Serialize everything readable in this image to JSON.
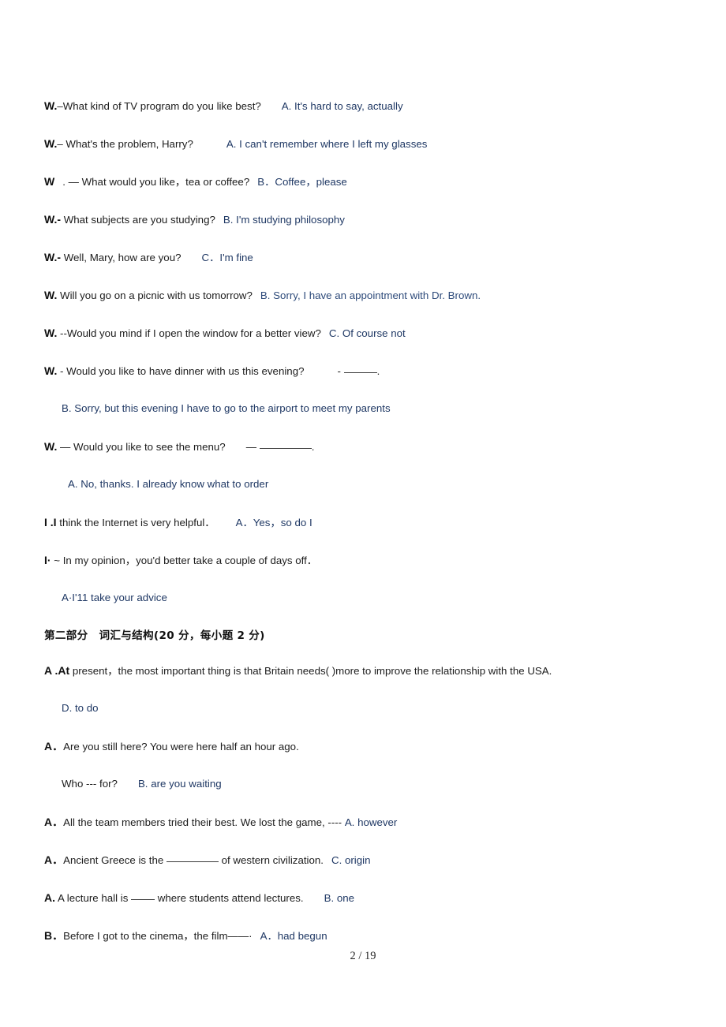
{
  "document": {
    "page_number": "2",
    "page_total": "19",
    "footer_text": "2 / 19",
    "colors": {
      "answer_blue": "#1f3864",
      "body_black": "#1c1c1c",
      "background": "#ffffff"
    }
  },
  "part_one": {
    "questions": [
      {
        "letter": "W.",
        "stem": "–What kind of TV program do you like best?",
        "answer": "A. It's hard to say, actually"
      },
      {
        "letter": "W.",
        "stem": "– What's the problem, Harry?",
        "answer": "A. I can't remember where I left my glasses"
      },
      {
        "letter": "W",
        "stem": ". — What would you like，tea or coffee?",
        "answer": "B．Coffee，please"
      },
      {
        "letter": "W.-",
        "stem": " What subjects are you studying?",
        "answer": "B. I'm    studying    philosophy"
      },
      {
        "letter": "W.-",
        "stem": " Well, Mary, how are you?",
        "answer": "C．I'm fine"
      },
      {
        "letter": "W.",
        "stem": " Will you go on a picnic with us tomorrow?",
        "answer": "B. Sorry, I have an appointment with Dr. Brown."
      },
      {
        "letter": "W.",
        "stem": " --Would you mind if I open the window for a better view?",
        "answer": "C. Of course not"
      }
    ],
    "question_8": {
      "letter": "W.",
      "stem": " - Would you like to have dinner with us this evening?",
      "blank_prefix": "-",
      "blank_suffix": ".",
      "answer": "B. Sorry, but this evening I have to go to the airport to meet my parents"
    },
    "question_9": {
      "letter": "W.",
      "stem": " — Would you like to see the menu?",
      "blank_prefix": "—",
      "blank_suffix": ".",
      "answer": "A. No, thanks. I already know what to order"
    },
    "question_10": {
      "letter": "I .I",
      "stem": " think the Internet is very helpful．",
      "answer": "A．Yes，so do I"
    },
    "question_11": {
      "letter": "I·",
      "stem": " ~ In my opinion，you'd better take a couple of days off．",
      "answer": "A·I'11 take your advice"
    }
  },
  "part_two": {
    "heading": "第二部分　词汇与结构(20 分，每小题 2 分)",
    "questions": [
      {
        "letter": "A .At",
        "stem": " present，the most important thing is that Britain needs(  )more to improve the relationship with the USA.",
        "answer": "D.  to do",
        "answer_on_next_line": true
      },
      {
        "letter": "A．",
        "stem": "Are you still here? You were here half an hour ago.",
        "followup": "Who    ---    for?",
        "answer": "B. are you waiting",
        "answer_on_next_line": true
      },
      {
        "letter": "A．",
        "stem": "All the team members tried their best. We lost the game, ----",
        "answer": "A. however",
        "answer_on_next_line": false
      },
      {
        "letter": "A．",
        "stem_before_blank": "Ancient Greece is the ",
        "stem_after_blank": " of western civilization.",
        "answer": "C. origin",
        "answer_on_next_line": false
      },
      {
        "letter": "A.",
        "stem_before_blank": " A lecture hall is ",
        "stem_after_blank": " where students attend lectures.",
        "answer": "B. one",
        "answer_on_next_line": false
      },
      {
        "letter": "B．",
        "stem": "Before I got to the cinema，the film——·",
        "answer": "A．had begun",
        "answer_on_next_line": false
      }
    ]
  }
}
